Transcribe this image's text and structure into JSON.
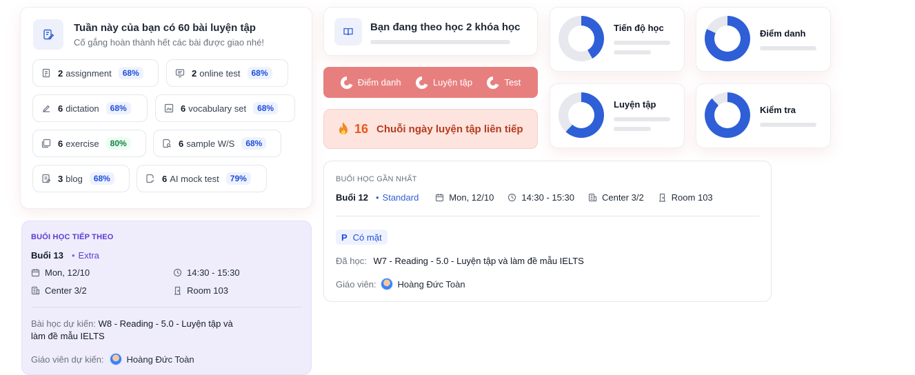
{
  "summary": {
    "title": "Tuần này của bạn có 60 bài luyện tập",
    "subtitle": "Cố gắng hoàn thành hết các bài được giao nhé!",
    "chips": [
      {
        "count": "2",
        "label": "assignment",
        "pct": "68%"
      },
      {
        "count": "2",
        "label": "online test",
        "pct": "68%"
      },
      {
        "count": "6",
        "label": "dictation",
        "pct": "68%"
      },
      {
        "count": "6",
        "label": "vocabulary set",
        "pct": "68%"
      },
      {
        "count": "6",
        "label": "exercise",
        "pct": "80%"
      },
      {
        "count": "6",
        "label": "sample W/S",
        "pct": "68%"
      },
      {
        "count": "3",
        "label": "blog",
        "pct": "68%"
      },
      {
        "count": "6",
        "label": "AI mock test",
        "pct": "79%"
      }
    ]
  },
  "courses": {
    "title": "Bạn đang theo học 2 khóa học"
  },
  "legend": {
    "items": [
      "Điểm danh",
      "Luyện tập",
      "Test"
    ]
  },
  "streak": {
    "count": "16",
    "label": "Chuỗi ngày luyện tập liên tiếp"
  },
  "stats": [
    {
      "label": "Tiến độ học",
      "fraction": 0.42
    },
    {
      "label": "Điểm danh",
      "fraction": 0.82
    },
    {
      "label": "Luyện tập",
      "fraction": 0.62
    },
    {
      "label": "Kiểm tra",
      "fraction": 0.88
    }
  ],
  "colors": {
    "accent": "#2f5fd6",
    "track": "#e6e8ee",
    "legend_red": "#e87f7f",
    "next_bg": "#efedfb",
    "next_accent": "#5b3bd6"
  },
  "next_session": {
    "heading": "BUỔI HỌC TIẾP THEO",
    "session": "Buổi 13",
    "tag": "Extra",
    "date": "Mon, 12/10",
    "time": "14:30 - 15:30",
    "center": "Center 3/2",
    "room": "Room 103",
    "lesson_label": "Bài học dự kiến:",
    "lesson_value": "W8  - Reading - 5.0 - Luyện tập và làm đề mẫu IELTS",
    "teacher_label": "Giáo viên dự kiến:",
    "teacher_name": "Hoàng Đức Toàn"
  },
  "recent_session": {
    "heading": "BUỔI HỌC GẦN NHẤT",
    "session": "Buổi 12",
    "tag": "Standard",
    "date": "Mon, 12/10",
    "time": "14:30 - 15:30",
    "center": "Center 3/2",
    "room": "Room 103",
    "attendance_code": "P",
    "attendance_label": "Có mặt",
    "lesson_label": "Đã học:",
    "lesson_value": "W7 - Reading - 5.0 - Luyện tập và làm đề mẫu IELTS",
    "teacher_label": "Giáo viên:",
    "teacher_name": "Hoàng Đức Toàn"
  }
}
